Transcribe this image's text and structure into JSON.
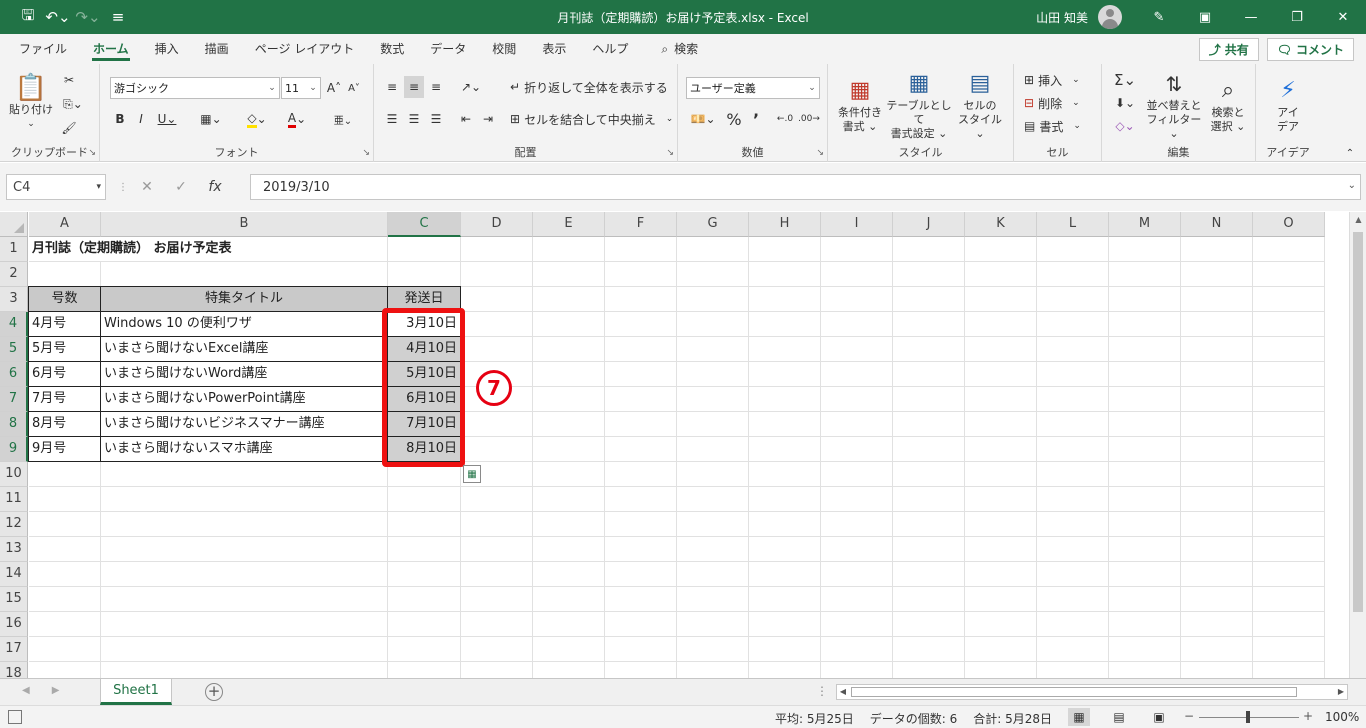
{
  "window": {
    "title": "月刊誌（定期購読）お届け予定表.xlsx  -  Excel",
    "user_name": "山田 知美"
  },
  "ribbon_tabs": [
    "ファイル",
    "ホーム",
    "挿入",
    "描画",
    "ページ レイアウト",
    "数式",
    "データ",
    "校閲",
    "表示",
    "ヘルプ"
  ],
  "search_label": "検索",
  "share_label": "共有",
  "comment_label": "コメント",
  "ribbon": {
    "clipboard": {
      "label": "クリップボード",
      "paste": "貼り付け"
    },
    "font": {
      "label": "フォント",
      "font_name": "游ゴシック",
      "font_size": "11"
    },
    "alignment": {
      "label": "配置",
      "wrap": "折り返して全体を表示する",
      "merge": "セルを結合して中央揃え"
    },
    "number": {
      "label": "数値",
      "format": "ユーザー定義"
    },
    "styles": {
      "label": "スタイル",
      "conditional": [
        "条件付き",
        "書式"
      ],
      "table": [
        "テーブルとして",
        "書式設定"
      ],
      "cell_styles": [
        "セルの",
        "スタイル"
      ]
    },
    "cells": {
      "label": "セル",
      "insert": "挿入",
      "delete": "削除",
      "format": "書式"
    },
    "editing": {
      "label": "編集",
      "sort": [
        "並べ替えと",
        "フィルター"
      ],
      "find": [
        "検索と",
        "選択"
      ]
    },
    "ideas": {
      "label": "アイデア",
      "button": [
        "アイ",
        "デア"
      ]
    }
  },
  "formula_bar": {
    "name_box": "C4",
    "fx": "fx",
    "value": "2019/3/10"
  },
  "columns": [
    "A",
    "B",
    "C",
    "D",
    "E",
    "F",
    "G",
    "H",
    "I",
    "J",
    "K",
    "L",
    "M",
    "N",
    "O"
  ],
  "rows": [
    "1",
    "2",
    "3",
    "4",
    "5",
    "6",
    "7",
    "8",
    "9",
    "10",
    "11",
    "12",
    "13",
    "14",
    "15",
    "16",
    "17",
    "18"
  ],
  "sheet": {
    "title": "月刊誌（定期購読） お届け予定表",
    "headers": [
      "号数",
      "特集タイトル",
      "発送日"
    ],
    "data": [
      [
        "4月号",
        "Windows 10 の便利ワザ",
        "3月10日"
      ],
      [
        "5月号",
        "いまさら聞けないExcel講座",
        "4月10日"
      ],
      [
        "6月号",
        "いまさら聞けないWord講座",
        "5月10日"
      ],
      [
        "7月号",
        "いまさら聞けないPowerPoint講座",
        "6月10日"
      ],
      [
        "8月号",
        "いまさら聞けないビジネスマナー講座",
        "7月10日"
      ],
      [
        "9月号",
        "いまさら聞けないスマホ講座",
        "8月10日"
      ]
    ]
  },
  "annotation": {
    "step": "7",
    "color": "#ee1111"
  },
  "sheet_tab": "Sheet1",
  "status": {
    "average": "平均: 5月25日",
    "count": "データの個数: 6",
    "sum": "合計: 5月28日",
    "zoom": "100%"
  },
  "colors": {
    "accent": "#217346"
  }
}
